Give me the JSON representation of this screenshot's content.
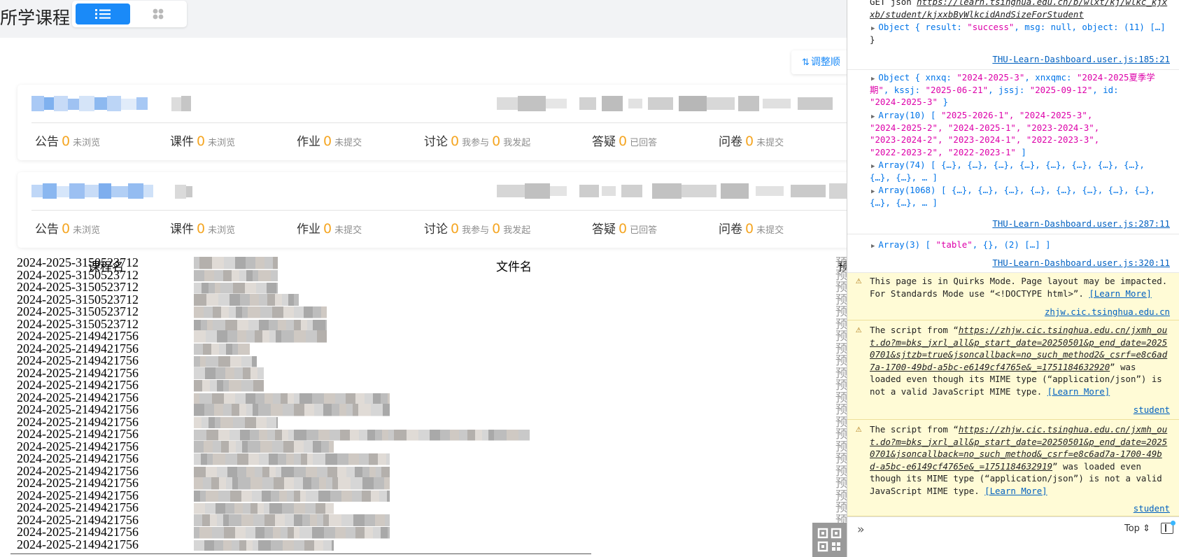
{
  "page": {
    "title": "所学课程",
    "sort_label": "调整顺",
    "sort_icon": "sort-arrows"
  },
  "cards": [
    {
      "stats": [
        {
          "label": "公告",
          "count": "0",
          "status": "未浏览"
        },
        {
          "label": "课件",
          "count": "0",
          "status": "未浏览"
        },
        {
          "label": "作业",
          "count": "0",
          "status": "未提交"
        },
        {
          "label": "讨论",
          "count": "0",
          "status": "我参与",
          "count2": "0",
          "status2": "我发起"
        },
        {
          "label": "答疑",
          "count": "0",
          "status": "已回答"
        },
        {
          "label": "问卷",
          "count": "0",
          "status": "未提交"
        }
      ]
    },
    {
      "stats": [
        {
          "label": "公告",
          "count": "0",
          "status": "未浏览"
        },
        {
          "label": "课件",
          "count": "0",
          "status": "未浏览"
        },
        {
          "label": "作业",
          "count": "0",
          "status": "未提交"
        },
        {
          "label": "讨论",
          "count": "0",
          "status": "我参与",
          "count2": "0",
          "status2": "我发起"
        },
        {
          "label": "答疑",
          "count": "0",
          "status": "已回答"
        },
        {
          "label": "问卷",
          "count": "0",
          "status": "未提交"
        }
      ]
    }
  ],
  "file_table": {
    "columns": [
      "课程名",
      "文件名",
      "预"
    ],
    "rows": [
      {
        "course": "2024-2025-3150523712",
        "preview": "预"
      },
      {
        "course": "2024-2025-3150523712",
        "preview": "预"
      },
      {
        "course": "2024-2025-3150523712",
        "preview": "预"
      },
      {
        "course": "2024-2025-3150523712",
        "preview": "预"
      },
      {
        "course": "2024-2025-3150523712",
        "preview": "预"
      },
      {
        "course": "2024-2025-3150523712",
        "preview": "预"
      },
      {
        "course": "2024-2025-2149421756",
        "preview": "预"
      },
      {
        "course": "2024-2025-2149421756",
        "preview": "预"
      },
      {
        "course": "2024-2025-2149421756",
        "preview": "预"
      },
      {
        "course": "2024-2025-2149421756",
        "preview": "预"
      },
      {
        "course": "2024-2025-2149421756",
        "preview": "预"
      },
      {
        "course": "2024-2025-2149421756",
        "preview": "预"
      },
      {
        "course": "2024-2025-2149421756",
        "preview": "预"
      },
      {
        "course": "2024-2025-2149421756",
        "preview": "预"
      },
      {
        "course": "2024-2025-2149421756",
        "preview": "预"
      },
      {
        "course": "2024-2025-2149421756",
        "preview": "预"
      },
      {
        "course": "2024-2025-2149421756",
        "preview": "预"
      },
      {
        "course": "2024-2025-2149421756",
        "preview": "预"
      },
      {
        "course": "2024-2025-2149421756",
        "preview": "预"
      },
      {
        "course": "2024-2025-2149421756",
        "preview": "预"
      },
      {
        "course": "2024-2025-2149421756",
        "preview": "预"
      },
      {
        "course": "2024-2025-2149421756",
        "preview": "预"
      },
      {
        "course": "2024-2025-2149421756",
        "preview": "预"
      },
      {
        "course": "2024-2025-2149421756",
        "preview": "预"
      }
    ]
  },
  "devtools": {
    "log1": {
      "method": "GET json ",
      "url": "https://learn.tsinghua.edu.cn/b/wlxt/kj/wlkc_kjxxb/student/kjxxbByWlkcidAndSizeForStudent",
      "url_line1": "https://learn.tsinghua.edu.cn/b/wlxt/kj/wlkc_kjx",
      "url_line2": "xb/student/kjxxbByWlkcidAndSizeForStudent",
      "obj_prefix": "Object { result: ",
      "obj_result": "\"success\"",
      "obj_mid": ", msg: null, object: (11) […]",
      "obj_end": "}",
      "source": "THU-Learn-Dashboard.user.js:185:21"
    },
    "log2": {
      "l1_prefix": "Object { xnxq: ",
      "l1_xnxq": "\"2024-2025-3\"",
      "l1_mid": ", xnxqmc: ",
      "l1_xnxqmc_a": "\"2024-2025夏季学",
      "l2_xnxqmc_b": "期\"",
      "l2_mid": ", kssj: ",
      "l2_kssj": "\"2025-06-21\"",
      "l2_mid2": ", jssj: ",
      "l2_jssj": "\"2025-09-12\"",
      "l2_end": ", id:",
      "l3_id": "\"2024-2025-3\"",
      "l3_end": " }",
      "arr1_head": "Array(10) [ ",
      "arr1_a": "\"2025-2026-1\", \"2024-2025-3\",",
      "arr1_b": "\"2024-2025-2\", \"2024-2025-1\", \"2023-2024-3\",",
      "arr1_c": "\"2023-2024-2\", \"2023-2024-1\", \"2022-2023-3\",",
      "arr1_d": "\"2022-2023-2\", \"2022-2023-1\"",
      "arr1_end": " ]",
      "arr2_a": "Array(74) [ {…}, {…}, {…}, {…}, {…}, {…}, {…}, {…},",
      "arr2_b": "{…}, {…}, … ]",
      "arr3_a": "Array(1068) [ {…}, {…}, {…}, {…}, {…}, {…}, {…}, {…},",
      "arr3_b": "{…}, {…}, … ]",
      "source": "THU-Learn-Dashboard.user.js:287:11"
    },
    "log3": {
      "text_a": "Array(3) [ ",
      "text_b": "\"table\"",
      "text_c": ", {}, (2) […] ]",
      "source": "THU-Learn-Dashboard.user.js:320:11"
    },
    "warn1": {
      "line1": "This page is in Quirks Mode. Page layout may be impacted.",
      "line2": "For Standards Mode use “<!DOCTYPE html>”. ",
      "learn_more": "[Learn More]",
      "source": "zhjw.cic.tsinghua.edu.cn"
    },
    "warn2": {
      "prefix": "The script from “",
      "url1": "https://zhjw.cic.tsinghua.edu.cn/jxmh_ou",
      "url2": "t.do?m=bks_jxrl_all&p_start_date=20250501&p_end_date=2025",
      "url3": "0701&sjtzb=true&jsoncallback=no_such_method2&_csrf=e8c6ad",
      "url4": "7a-1700-49bd-a5bc-e6149cf4765e&_=1751184632920",
      "tail4": "” was",
      "line5": "loaded even though its MIME type (“application/json”) is",
      "line6": "not a valid JavaScript MIME type. ",
      "learn_more": "[Learn More]",
      "source": "student"
    },
    "warn3": {
      "prefix": "The script from “",
      "url1": "https://zhjw.cic.tsinghua.edu.cn/jxmh_ou",
      "url2": "t.do?m=bks_jxrl_all&p_start_date=20250501&p_end_date=2025",
      "url3": "0701&jsoncallback=no_such_method&_csrf=e8c6ad7a-1700-49b",
      "url4": "d-a5bc-e6149cf4765e&_=1751184632919",
      "tail4": "” was loaded even",
      "line5": "though its MIME type (“application/json”) is not a valid",
      "line6": "JavaScript MIME type. ",
      "learn_more": "[Learn More]",
      "source": "student"
    },
    "input": {
      "context": "Top ⇕"
    }
  },
  "colors": {
    "accent": "#1a8af8",
    "count": "#f5a623",
    "warning_bg": "#fffbd6",
    "string": "#dd00a9",
    "keyword": "#0074e8"
  }
}
